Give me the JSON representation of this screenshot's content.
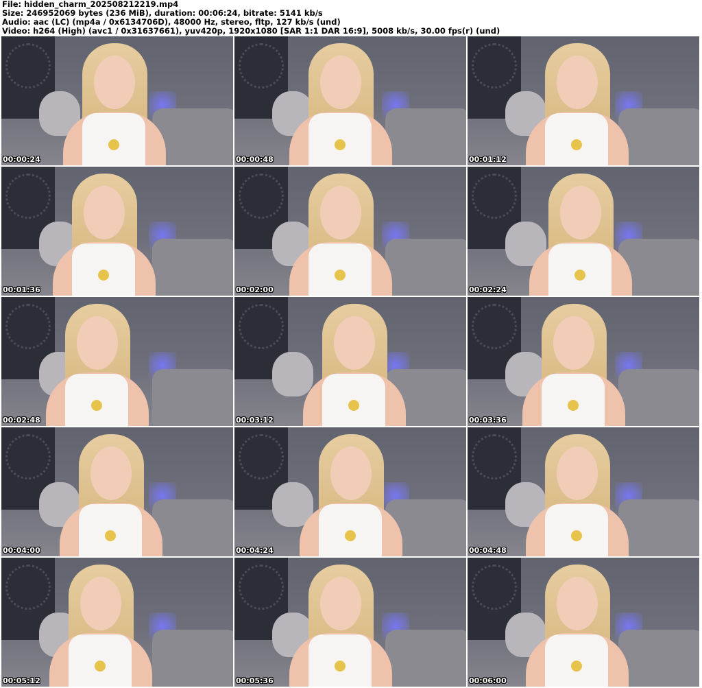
{
  "header": {
    "file_line": "File: hidden_charm_202508212219.mp4",
    "size_line": "Size: 246952069 bytes (236 MiB), duration: 00:06:24, bitrate: 5141 kb/s",
    "audio_line": "Audio: aac (LC) (mp4a / 0x6134706D), 48000 Hz, stereo, fltp, 127 kb/s (und)",
    "video_line": "Video: h264 (High) (avc1 / 0x31637661), yuv420p, 1920x1080 [SAR 1:1 DAR 16:9], 5008 kb/s, 30.00 fps(r) (und)"
  },
  "thumbnails": [
    {
      "timestamp": "00:00:24"
    },
    {
      "timestamp": "00:00:48"
    },
    {
      "timestamp": "00:01:12"
    },
    {
      "timestamp": "00:01:36"
    },
    {
      "timestamp": "00:02:00"
    },
    {
      "timestamp": "00:02:24"
    },
    {
      "timestamp": "00:02:48"
    },
    {
      "timestamp": "00:03:12"
    },
    {
      "timestamp": "00:03:36"
    },
    {
      "timestamp": "00:04:00"
    },
    {
      "timestamp": "00:04:24"
    },
    {
      "timestamp": "00:04:48"
    },
    {
      "timestamp": "00:05:12"
    },
    {
      "timestamp": "00:05:36"
    },
    {
      "timestamp": "00:06:00"
    }
  ],
  "colors": {
    "background": "#ffffff",
    "timestamp_text": "#ffffff",
    "scene_wall": "#5a5c6a"
  }
}
